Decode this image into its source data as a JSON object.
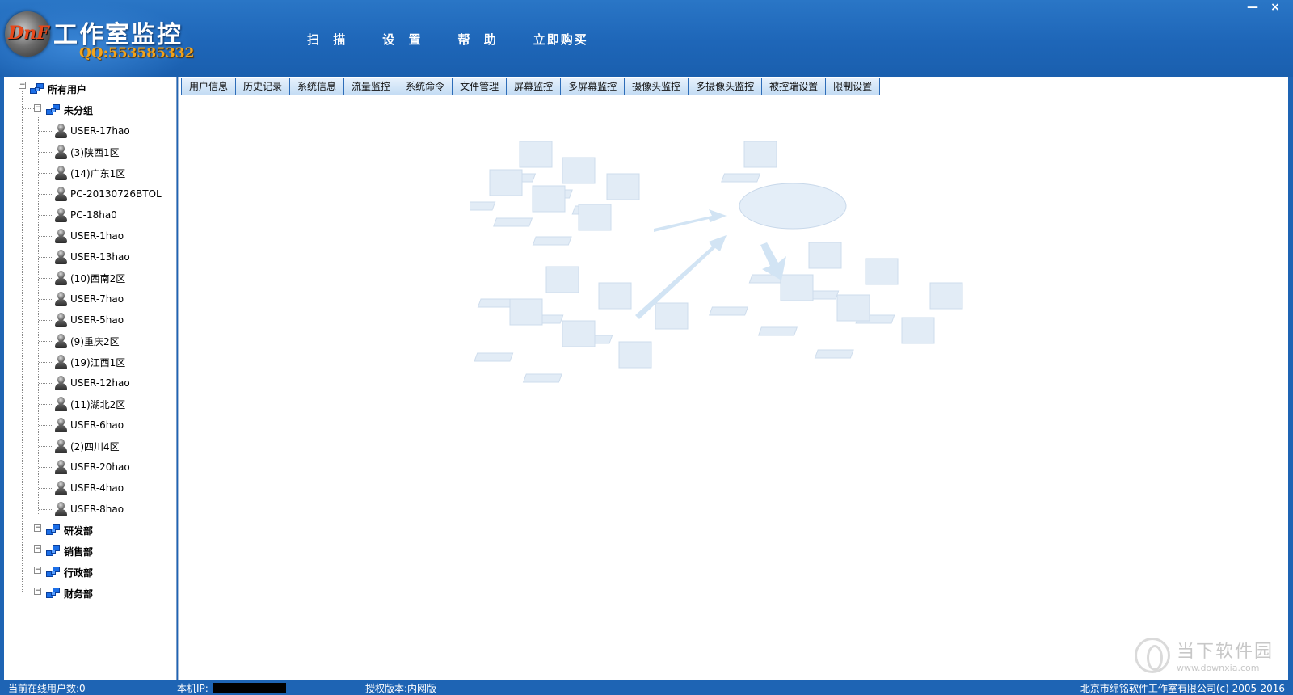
{
  "header": {
    "emblem_text": "DnF",
    "app_title": "工作室监控",
    "qq": "QQ:553585332"
  },
  "main_menu": {
    "scan": "扫 描",
    "settings": "设 置",
    "help": "帮 助",
    "buy": "立即购买"
  },
  "window_controls": {
    "minimize": "—",
    "close": "×"
  },
  "tree": {
    "root": "所有用户",
    "groups": [
      {
        "label": "未分组",
        "users": [
          "USER-17hao",
          "(3)陕西1区",
          "(14)广东1区",
          "PC-20130726BTOL",
          "PC-18ha0",
          "USER-1hao",
          "USER-13hao",
          "(10)西南2区",
          "USER-7hao",
          "USER-5hao",
          "(9)重庆2区",
          "(19)江西1区",
          "USER-12hao",
          "(11)湖北2区",
          "USER-6hao",
          "(2)四川4区",
          "USER-20hao",
          "USER-4hao",
          "USER-8hao"
        ]
      },
      {
        "label": "研发部"
      },
      {
        "label": "销售部"
      },
      {
        "label": "行政部"
      },
      {
        "label": "财务部"
      }
    ]
  },
  "tabs": [
    "用户信息",
    "历史记录",
    "系统信息",
    "流量监控",
    "系统命令",
    "文件管理",
    "屏幕监控",
    "多屏幕监控",
    "摄像头监控",
    "多摄像头监控",
    "被控端设置",
    "限制设置"
  ],
  "watermark": {
    "title": "当下软件园",
    "url": "www.downxia.com"
  },
  "status_bar": {
    "online_users": "当前在线用户数:0",
    "local_ip_label": "本机IP:",
    "license": "授权版本:内网版",
    "copyright": "北京市绵铭软件工作室有限公司(c) 2005-2016"
  },
  "colors": {
    "frame_blue": "#1e64b4",
    "tab_border": "#2c6cb8",
    "qq_orange": "#f2a41c",
    "group_icon_blue": "#1c6fe8"
  }
}
